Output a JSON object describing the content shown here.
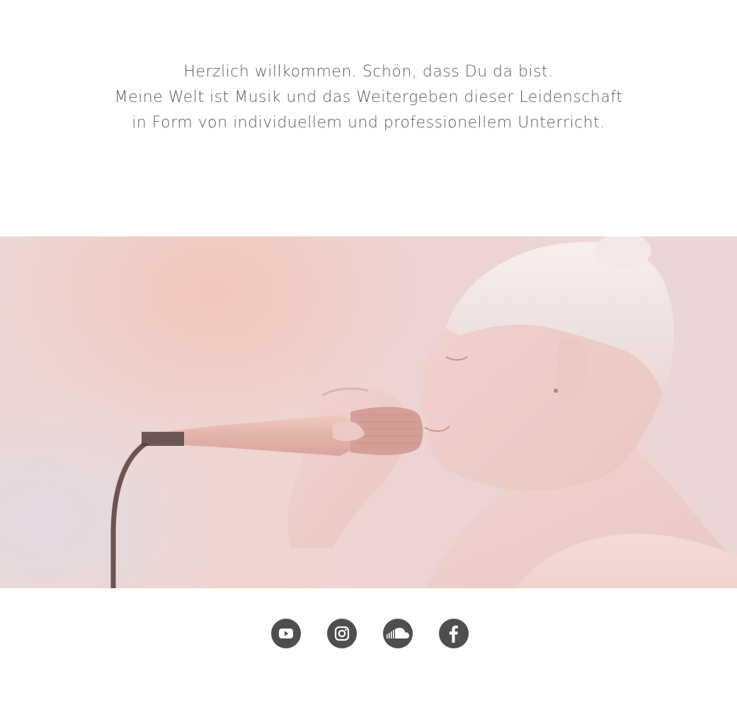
{
  "intro": {
    "line1": "Herzlich willkommen. Schön, dass Du da bist.",
    "line2": "Meine Welt ist Musik und das Weitergeben dieser Leidenschaft",
    "line3": "in Form von individuellem und professionellem Unterricht."
  },
  "hero": {
    "icon": "singer-with-microphone-photo",
    "tint": "#efd5d0"
  },
  "social": {
    "icon_color": "#4e4e4e",
    "items": [
      {
        "name": "youtube",
        "icon": "youtube-icon"
      },
      {
        "name": "instagram",
        "icon": "instagram-icon"
      },
      {
        "name": "soundcloud",
        "icon": "soundcloud-icon"
      },
      {
        "name": "facebook",
        "icon": "facebook-icon"
      }
    ]
  }
}
